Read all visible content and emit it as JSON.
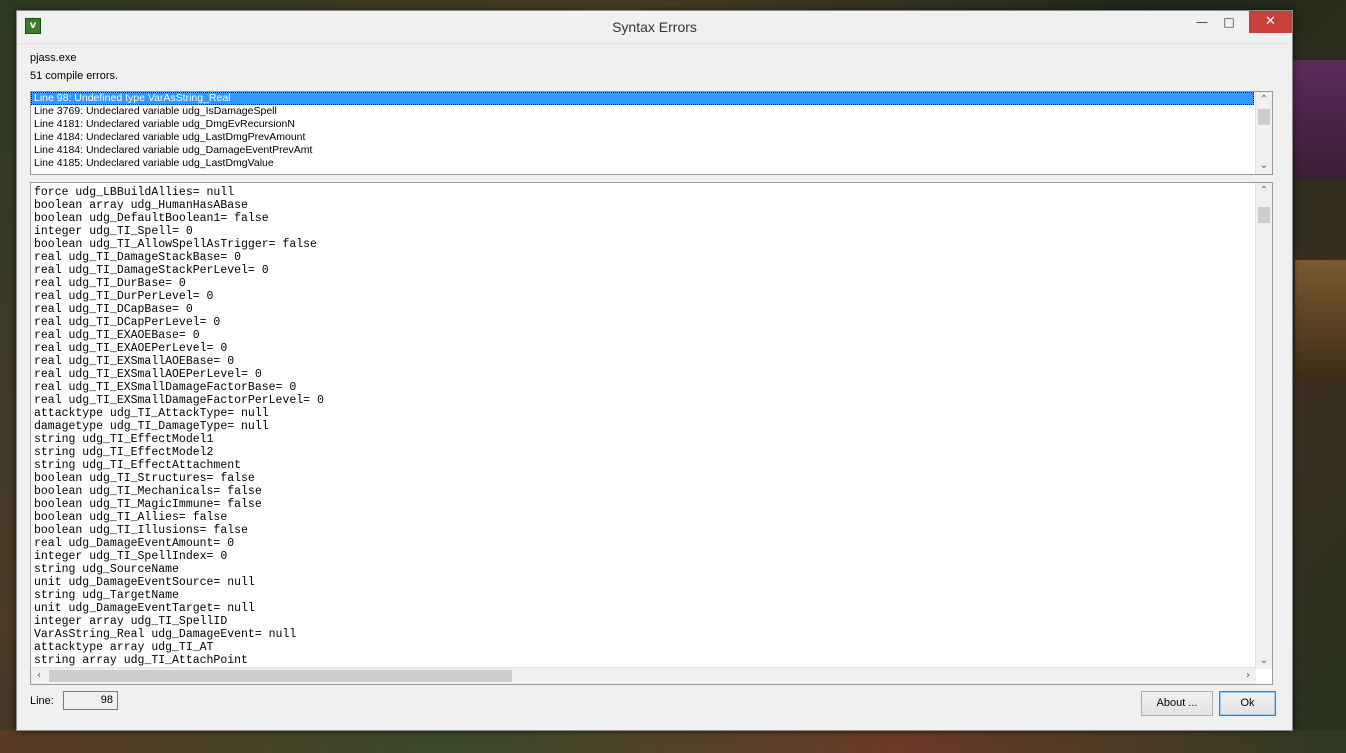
{
  "window": {
    "title": "Syntax Errors",
    "icon_name": "app-icon",
    "controls": {
      "minimize": "—",
      "maximize": "□",
      "close": "✕"
    }
  },
  "header": {
    "program": "pjass.exe",
    "summary": "51 compile errors."
  },
  "errors": [
    "Line 98:  Undefined type VarAsString_Real",
    "Line 3769:  Undeclared variable udg_IsDamageSpell",
    "Line 4181:  Undeclared variable udg_DmgEvRecursionN",
    "Line 4184:  Undeclared variable udg_LastDmgPrevAmount",
    "Line 4184:  Undeclared variable udg_DamageEventPrevAmt",
    "Line 4185:  Undeclared variable udg_LastDmgValue"
  ],
  "selected_error_index": 0,
  "code_lines": [
    "force udg_LBBuildAllies= null",
    "boolean array udg_HumanHasABase",
    "boolean udg_DefaultBoolean1= false",
    "integer udg_TI_Spell= 0",
    "boolean udg_TI_AllowSpellAsTrigger= false",
    "real udg_TI_DamageStackBase= 0",
    "real udg_TI_DamageStackPerLevel= 0",
    "real udg_TI_DurBase= 0",
    "real udg_TI_DurPerLevel= 0",
    "real udg_TI_DCapBase= 0",
    "real udg_TI_DCapPerLevel= 0",
    "real udg_TI_EXAOEBase= 0",
    "real udg_TI_EXAOEPerLevel= 0",
    "real udg_TI_EXSmallAOEBase= 0",
    "real udg_TI_EXSmallAOEPerLevel= 0",
    "real udg_TI_EXSmallDamageFactorBase= 0",
    "real udg_TI_EXSmallDamageFactorPerLevel= 0",
    "attacktype udg_TI_AttackType= null",
    "damagetype udg_TI_DamageType= null",
    "string udg_TI_EffectModel1",
    "string udg_TI_EffectModel2",
    "string udg_TI_EffectAttachment",
    "boolean udg_TI_Structures= false",
    "boolean udg_TI_Mechanicals= false",
    "boolean udg_TI_MagicImmune= false",
    "boolean udg_TI_Allies= false",
    "boolean udg_TI_Illusions= false",
    "real udg_DamageEventAmount= 0",
    "integer udg_TI_SpellIndex= 0",
    "string udg_SourceName",
    "unit udg_DamageEventSource= null",
    "string udg_TargetName",
    "unit udg_DamageEventTarget= null",
    "integer array udg_TI_SpellID",
    "VarAsString_Real udg_DamageEvent= null",
    "attacktype array udg_TI_AT",
    "string array udg_TI_AttachPoint"
  ],
  "footer": {
    "line_label": "Line:",
    "line_value": "98",
    "about_label": "About ...",
    "ok_label": "Ok"
  },
  "colors": {
    "selection": "#3399ff",
    "close_button": "#c7403a",
    "window_bg": "#f0f0f0"
  }
}
